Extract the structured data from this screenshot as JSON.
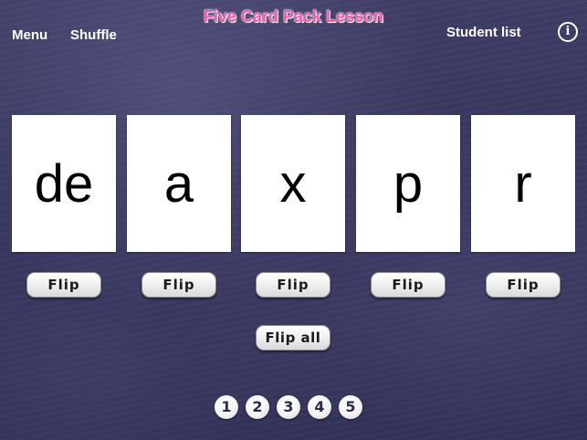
{
  "header": {
    "title": "Five Card Pack Lesson",
    "menu_label": "Menu",
    "shuffle_label": "Shuffle",
    "student_list_label": "Student list",
    "info_icon": "i"
  },
  "cards": [
    {
      "text": "de"
    },
    {
      "text": "a"
    },
    {
      "text": "x"
    },
    {
      "text": "p"
    },
    {
      "text": "r"
    }
  ],
  "buttons": {
    "flip_label": "Flip",
    "flip_all_label": "Flip all"
  },
  "pages": [
    "1",
    "2",
    "3",
    "4",
    "5"
  ],
  "colors": {
    "title": "#f05aa8",
    "background": "#34335a",
    "card": "#ffffff"
  }
}
